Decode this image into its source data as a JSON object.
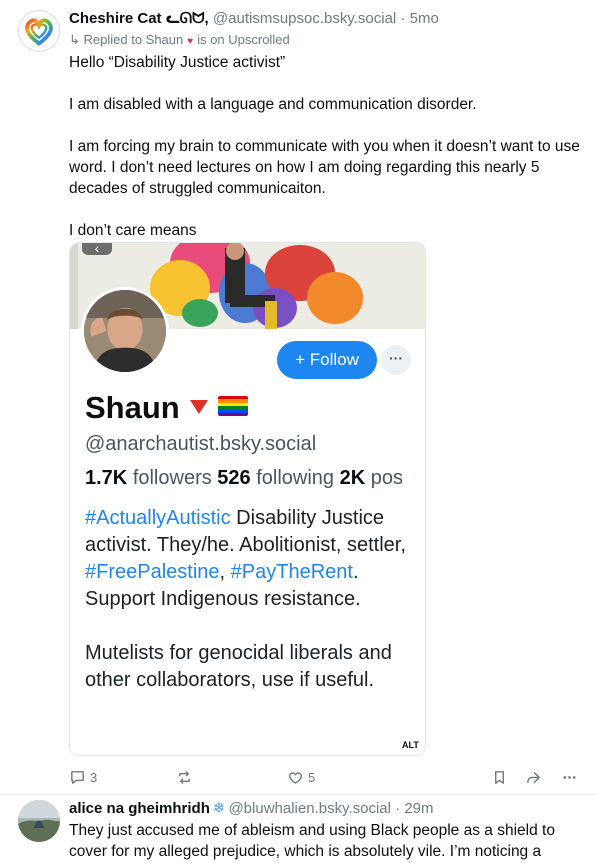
{
  "post": {
    "author_name": "Cheshire Cat ᓚᘏᗢ,",
    "author_handle": "@autismsupsoc.bsky.social",
    "separator": " · ",
    "time": "5mo",
    "reply_prefix": "↳ Replied to Shaun",
    "reply_suffix": "is on Upscrolled",
    "paragraphs": [
      "Hello “Disability Justice activist”",
      "I am disabled with a language and communication disorder.",
      "I am forcing my brain to communicate with you when it doesn’t want to use word. I don’t need lectures on how I am doing regarding this nearly 5 decades of struggled communicaiton.",
      "I don’t care means"
    ],
    "embed": {
      "follow_label": "+ Follow",
      "more_label": "···",
      "name": "Shaun",
      "handle": "@anarchautist.bsky.social",
      "followers_count": "1.7K",
      "followers_label": "followers",
      "following_count": "526",
      "following_label": "following",
      "posts_count": "2K",
      "posts_label": "pos",
      "bio": {
        "tag1": "#ActuallyAutistic",
        "line1_rest": " Disability Justice activist. They/he. Abolitionist, settler, ",
        "tag2": "#FreePalestine",
        "comma": ", ",
        "tag3": "#PayTheRent",
        "line1_end": ". Support Indigenous resistance.",
        "paragraph2": "Mutelists for genocidal liberals and other collaborators, use if useful."
      },
      "alt_label": "ALT"
    },
    "actions": {
      "replies": "3",
      "likes": "5"
    }
  },
  "post2": {
    "author_name": "alice na gheimhridh",
    "author_handle": "@bluwhalien.bsky.social",
    "separator": " · ",
    "time": "29m",
    "text": "They just accused me of ableism and using Black people as a shield to cover for my alleged prejudice, which is absolutely vile. I’m noticing a"
  },
  "colors": {
    "accent": "#1d86f0",
    "muted": "#6f7b86",
    "heart": "#d3306f"
  }
}
